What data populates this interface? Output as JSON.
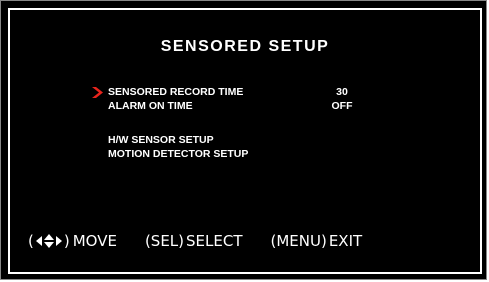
{
  "screen": {
    "title": "SENSORED SETUP",
    "menu_items": [
      {
        "label": "SENSORED RECORD TIME",
        "value": "30",
        "selected": true
      },
      {
        "label": "ALARM ON TIME",
        "value": "OFF",
        "selected": false
      },
      {
        "label": "H/W SENSOR SETUP",
        "value": "",
        "selected": false
      },
      {
        "label": "MOTION DETECTOR SETUP",
        "value": "",
        "selected": false
      }
    ],
    "cursor_icon": "red-chevron-right-icon"
  },
  "footer": {
    "move": {
      "open": "(",
      "close": ")",
      "label": "MOVE",
      "icon": "four-way-arrows-icon"
    },
    "select": {
      "key": "(SEL)",
      "label": "SELECT"
    },
    "exit": {
      "key": "(MENU)",
      "label": "EXIT"
    }
  },
  "colors": {
    "background": "#000000",
    "text": "#ffffff",
    "cursor": "#e8241c",
    "border": "#ffffff"
  }
}
